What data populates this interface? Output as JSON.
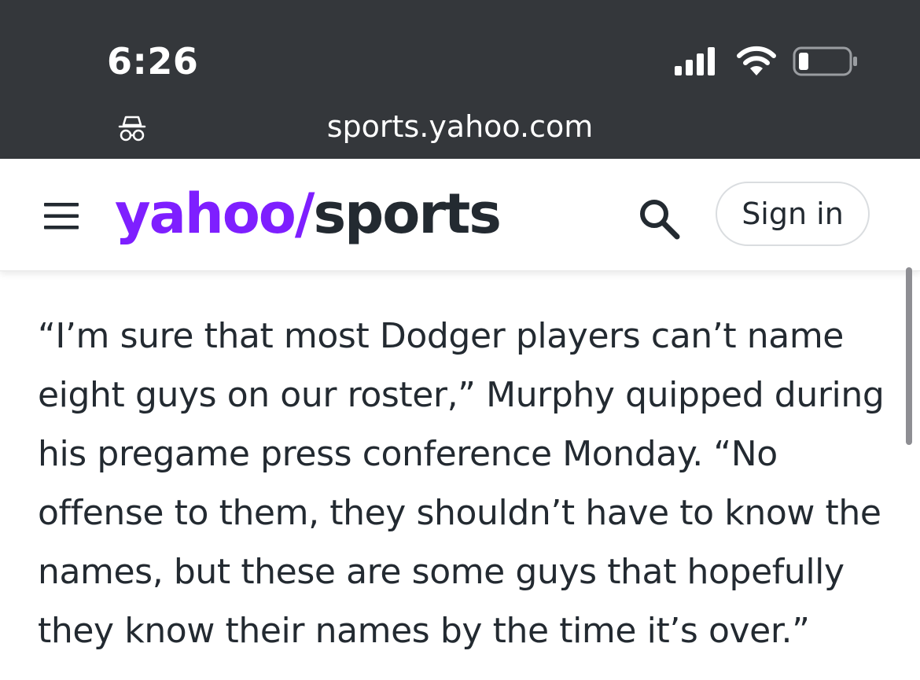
{
  "status_bar": {
    "time": "6:26"
  },
  "browser": {
    "url": "sports.yahoo.com"
  },
  "header": {
    "logo_yahoo": "yahoo/",
    "logo_sports": "sports",
    "signin_label": "Sign in"
  },
  "article": {
    "paragraph": "“I’m sure that most Dodger players can’t name eight guys on our roster,” Murphy quipped during his pregame press conference Monday. “No offense to them, they shouldn’t have to know the names, but these are some guys that hopefully they know their names by the time it’s over.”"
  },
  "colors": {
    "status_bg": "#34373b",
    "brand_purple": "#7e1fff",
    "text_dark": "#232a31"
  },
  "icons": [
    "signal-icon",
    "wifi-icon",
    "battery-icon",
    "incognito-icon",
    "hamburger-menu-icon",
    "search-icon"
  ]
}
